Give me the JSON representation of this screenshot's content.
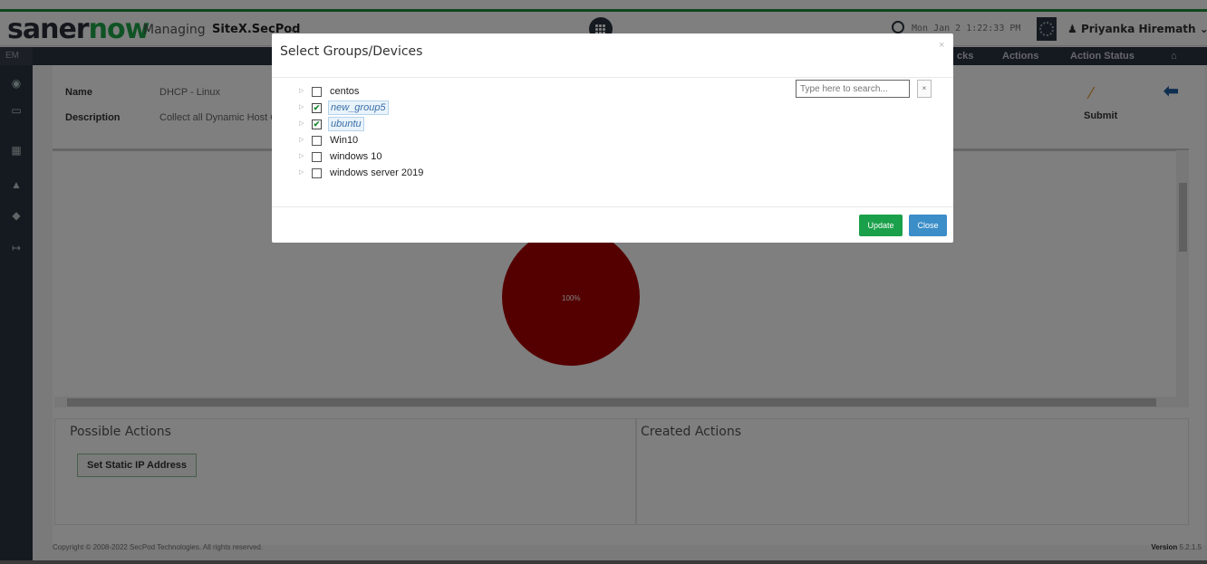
{
  "header": {
    "logo_part1": "saner",
    "logo_part2": "now",
    "managing_label": "Managing",
    "site_name": "SiteX.SecPod",
    "datetime": "Mon Jan 2 1:22:33 PM",
    "user_name": "Priyanka Hiremath"
  },
  "nav": {
    "module": "EM",
    "items": [
      "cks",
      "Actions",
      "Action Status"
    ]
  },
  "details": {
    "name_label": "Name",
    "name_value": "DHCP - Linux",
    "description_label": "Description",
    "description_value": "Collect all Dynamic Host C",
    "submit_label": "Submit"
  },
  "chart_data": {
    "type": "pie",
    "values": [
      100
    ],
    "labels": [
      "100%"
    ],
    "colors": [
      "#a00000"
    ]
  },
  "panels": {
    "possible_title": "Possible Actions",
    "possible_button": "Set Static IP Address",
    "created_title": "Created Actions"
  },
  "footer": {
    "copyright": "Copyright © 2008-2022 SecPod Technologies. All rights reserved.",
    "version_label": "Version",
    "version_value": "5.2.1.5"
  },
  "modal": {
    "title": "Select Groups/Devices",
    "close_glyph": "×",
    "search_placeholder": "Type here to search...",
    "search_clear": "×",
    "groups": [
      {
        "name": "centos",
        "checked": false
      },
      {
        "name": "new_group5",
        "checked": true
      },
      {
        "name": "ubuntu",
        "checked": true
      },
      {
        "name": "Win10",
        "checked": false
      },
      {
        "name": "windows 10",
        "checked": false
      },
      {
        "name": "windows server 2019",
        "checked": false
      }
    ],
    "update_label": "Update",
    "close_label": "Close"
  }
}
